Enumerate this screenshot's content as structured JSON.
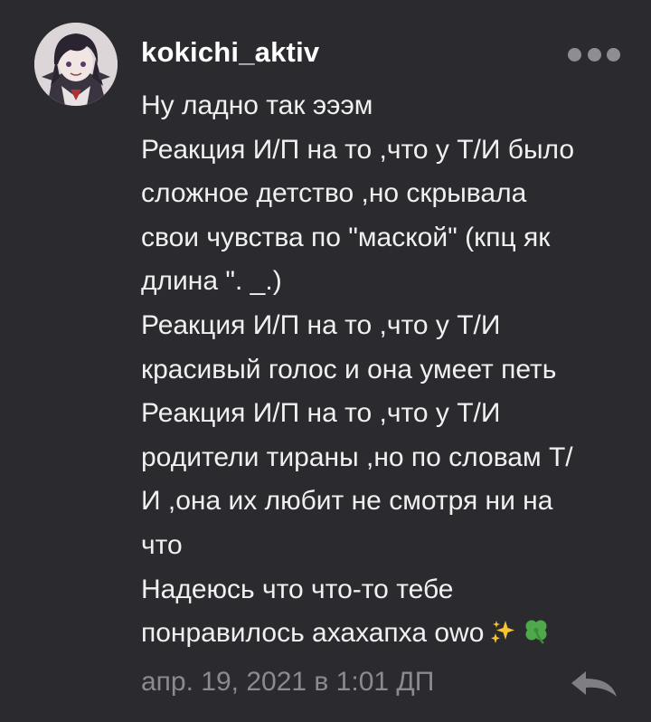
{
  "comment": {
    "author": "kokichi_aktiv",
    "lines": [
      "Ну ладно так эээм",
      "Реакция И/П на то ,что у Т/И было",
      "сложное детство ,но скрывала",
      "свои чувства по \"маской\" (кпц як",
      "длина \". _.)",
      "Реакция И/П на то ,что у Т/И",
      "красивый голос и она умеет петь",
      "Реакция И/П на то ,что у Т/И",
      "родители тираны ,но по словам Т/",
      "И ,она их любит не смотря ни на",
      "что",
      "Надеюсь что что-то тебе",
      "понравилось ахахапха owo"
    ],
    "emojis": [
      "sparkles-icon",
      "four-leaf-clover-icon"
    ],
    "timestamp": "апр. 19, 2021 в 1:01 ДП"
  },
  "icons": {
    "more": "more-options-icon",
    "reply": "reply-arrow-icon"
  },
  "colors": {
    "background": "#2b2a2e",
    "text": "#f0f0f0",
    "muted": "#8b8a8f"
  }
}
